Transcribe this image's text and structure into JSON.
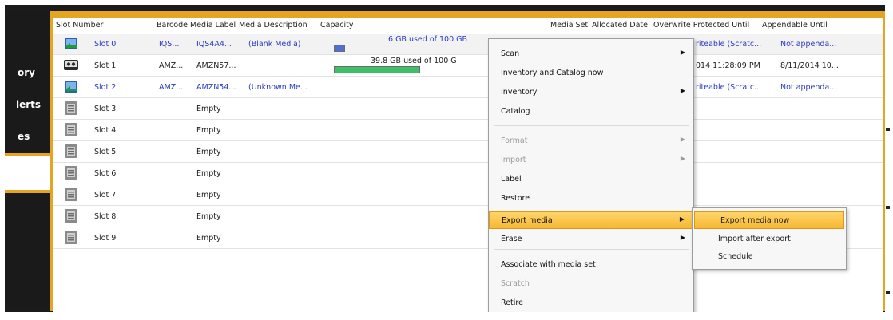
{
  "nav": {
    "items": [
      {
        "label": "ory"
      },
      {
        "label": "lerts"
      },
      {
        "label": "es"
      }
    ]
  },
  "columns": {
    "slot_number": "Slot Number",
    "barcode": "Barcode",
    "media_label": "Media Label",
    "media_description": "Media Description",
    "capacity": "Capacity",
    "media_set": "Media Set",
    "allocated_date": "Allocated Date",
    "overwrite_protected_until": "Overwrite Protected Until",
    "appendable_until": "Appendable Until"
  },
  "rows": [
    {
      "icon": "tape-blank-icon",
      "slot": "Slot 0",
      "barcode": "IQS...",
      "label": "IQS4A4...",
      "description": "(Blank Media)",
      "capacity_text": "6 GB used of 100 GB",
      "used_fraction": 0.06,
      "overwrite": "riteable (Scratc...",
      "appendable": "Not appenda...",
      "style": "blue"
    },
    {
      "icon": "tape-cassette-icon",
      "slot": "Slot 1",
      "barcode": "AMZ...",
      "label": "AMZN57...",
      "description": "",
      "capacity_text": "39.8 GB used of 100 G",
      "used_fraction": 0.398,
      "overwrite": "014 11:28:09 PM",
      "appendable": "8/11/2014 10...",
      "style": "normal"
    },
    {
      "icon": "tape-blank-icon",
      "slot": "Slot 2",
      "barcode": "AMZ...",
      "label": "AMZN54...",
      "description": "(Unknown Me...",
      "capacity_text": "",
      "used_fraction": null,
      "overwrite": "riteable (Scratc...",
      "appendable": "Not appenda...",
      "style": "blue"
    },
    {
      "icon": "empty-slot-icon",
      "slot": "Slot 3",
      "barcode": "",
      "label": "Empty",
      "description": "",
      "capacity_text": "",
      "used_fraction": null,
      "overwrite": "",
      "appendable": "",
      "style": "normal"
    },
    {
      "icon": "empty-slot-icon",
      "slot": "Slot 4",
      "barcode": "",
      "label": "Empty",
      "description": "",
      "capacity_text": "",
      "used_fraction": null,
      "overwrite": "",
      "appendable": "",
      "style": "normal"
    },
    {
      "icon": "empty-slot-icon",
      "slot": "Slot 5",
      "barcode": "",
      "label": "Empty",
      "description": "",
      "capacity_text": "",
      "used_fraction": null,
      "overwrite": "",
      "appendable": "",
      "style": "normal"
    },
    {
      "icon": "empty-slot-icon",
      "slot": "Slot 6",
      "barcode": "",
      "label": "Empty",
      "description": "",
      "capacity_text": "",
      "used_fraction": null,
      "overwrite": "",
      "appendable": "",
      "style": "normal"
    },
    {
      "icon": "empty-slot-icon",
      "slot": "Slot 7",
      "barcode": "",
      "label": "Empty",
      "description": "",
      "capacity_text": "",
      "used_fraction": null,
      "overwrite": "",
      "appendable": "",
      "style": "normal"
    },
    {
      "icon": "empty-slot-icon",
      "slot": "Slot 8",
      "barcode": "",
      "label": "Empty",
      "description": "",
      "capacity_text": "",
      "used_fraction": null,
      "overwrite": "",
      "appendable": "",
      "style": "normal"
    },
    {
      "icon": "empty-slot-icon",
      "slot": "Slot 9",
      "barcode": "",
      "label": "Empty",
      "description": "",
      "capacity_text": "",
      "used_fraction": null,
      "overwrite": "",
      "appendable": "",
      "style": "normal"
    }
  ],
  "context_menu": {
    "items": [
      {
        "label": "Scan",
        "submenu": true,
        "disabled": false
      },
      {
        "label": "Inventory and Catalog now",
        "submenu": false,
        "disabled": false
      },
      {
        "label": "Inventory",
        "submenu": true,
        "disabled": false
      },
      {
        "label": "Catalog",
        "submenu": false,
        "disabled": false
      },
      {
        "label": "Format",
        "submenu": true,
        "disabled": true
      },
      {
        "label": "Import",
        "submenu": true,
        "disabled": true
      },
      {
        "label": "Label",
        "submenu": false,
        "disabled": false
      },
      {
        "label": "Restore",
        "submenu": false,
        "disabled": false
      },
      {
        "label": "Export media",
        "submenu": true,
        "disabled": false,
        "highlighted": true
      },
      {
        "label": "Erase",
        "submenu": true,
        "disabled": false
      },
      {
        "label": "Associate with media set",
        "submenu": false,
        "disabled": false
      },
      {
        "label": "Scratch",
        "submenu": false,
        "disabled": true
      },
      {
        "label": "Retire",
        "submenu": false,
        "disabled": false
      }
    ]
  },
  "export_submenu": {
    "items": [
      {
        "label": "Export media now",
        "highlighted": true
      },
      {
        "label": "Import after export"
      },
      {
        "label": "Schedule"
      }
    ]
  },
  "colors": {
    "accent_orange": "#e4a523",
    "link_blue": "#2a39c2",
    "bar_green": "#3fbf6a",
    "bar_blue": "#4d6fd6",
    "menu_highlight": "#f7b733"
  }
}
